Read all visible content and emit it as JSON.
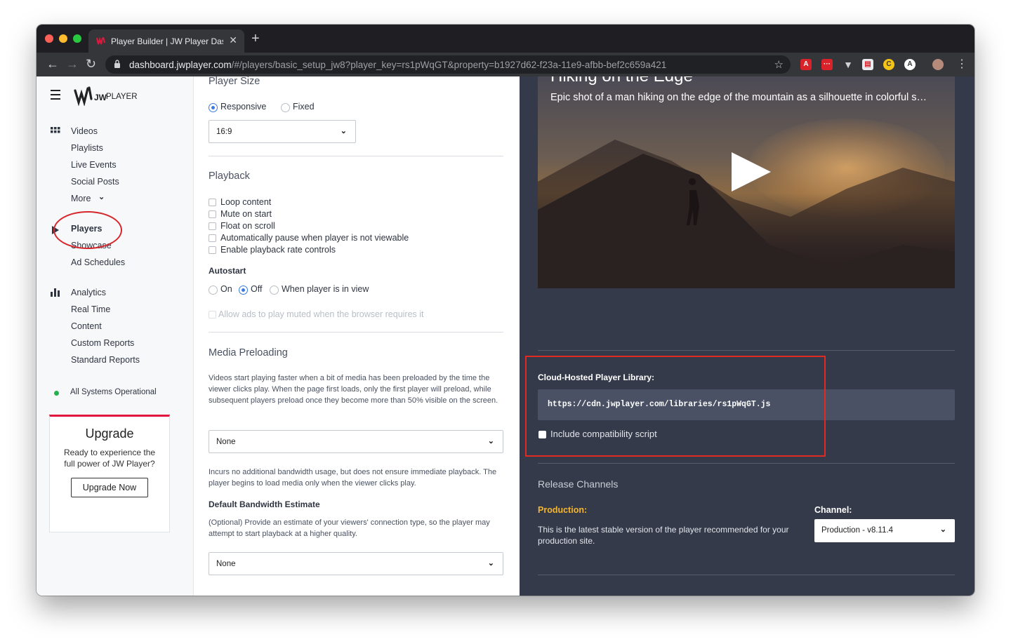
{
  "browser": {
    "tab_title": "Player Builder | JW Player Dashb",
    "url_host": "dashboard.jwplayer.com",
    "url_path": "/#/players/basic_setup_jw8?player_key=rs1pWqGT&property=b1927d62-f23a-11e9-afbb-bef2c659a421"
  },
  "logo": {
    "brand": "JW",
    "name": "PLAYER"
  },
  "sidebar": {
    "items": [
      {
        "label": "Videos"
      },
      {
        "label": "Playlists"
      },
      {
        "label": "Live Events"
      },
      {
        "label": "Social Posts"
      },
      {
        "label": "More"
      },
      {
        "label": "Players"
      },
      {
        "label": "Showcase"
      },
      {
        "label": "Ad Schedules"
      },
      {
        "label": "Analytics"
      },
      {
        "label": "Real Time"
      },
      {
        "label": "Content"
      },
      {
        "label": "Custom Reports"
      },
      {
        "label": "Standard Reports"
      }
    ],
    "status": "All Systems Operational",
    "upgrade": {
      "title": "Upgrade",
      "text": "Ready to experience the full power of JW Player?",
      "button": "Upgrade Now"
    }
  },
  "settings": {
    "player_size": {
      "title": "Player Size",
      "responsive": "Responsive",
      "fixed": "Fixed",
      "aspect_ratio": "16:9"
    },
    "playback": {
      "title": "Playback",
      "options": [
        "Loop content",
        "Mute on start",
        "Float on scroll",
        "Automatically pause when player is not viewable",
        "Enable playback rate controls"
      ],
      "autostart_label": "Autostart",
      "autostart_on": "On",
      "autostart_off": "Off",
      "autostart_inview": "When player is in view",
      "allow_ads": "Allow ads to play muted when the browser requires it"
    },
    "media_preloading": {
      "title": "Media Preloading",
      "description": "Videos start playing faster when a bit of media has been preloaded by the time the viewer clicks play. When the page first loads, only the first player will preload, while subsequent players preload once they become more than 50% visible on the screen.",
      "value": "None",
      "note": "Incurs no additional bandwidth usage, but does not ensure immediate playback. The player begins to load media only when the viewer clicks play."
    },
    "bandwidth": {
      "label": "Default Bandwidth Estimate",
      "description": "(Optional) Provide an estimate of your viewers' connection type, so the player may attempt to start playback at a higher quality.",
      "value": "None"
    }
  },
  "preview": {
    "video_title": "Hiking on the Edge",
    "video_description": "Epic shot of a man hiking on the edge of the mountain as a silhouette in colorful s…",
    "cloud_label": "Cloud-Hosted Player Library:",
    "library_url": "https://cdn.jwplayer.com/libraries/rs1pWqGT.js",
    "compat_label": "Include compatibility script",
    "release_title": "Release Channels",
    "production_label": "Production:",
    "production_desc": "This is the latest stable version of the player recommended for your production site.",
    "channel_label": "Channel:",
    "channel_value": "Production - v8.11.4"
  }
}
